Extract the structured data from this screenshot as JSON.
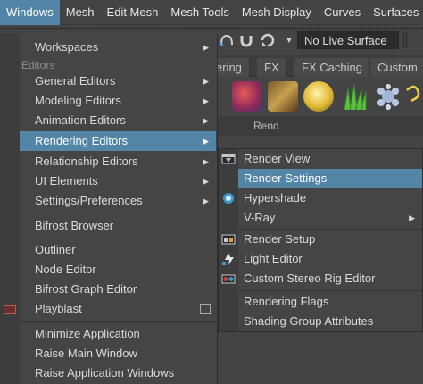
{
  "menubar": {
    "items": [
      "Windows",
      "Mesh",
      "Edit Mesh",
      "Mesh Tools",
      "Mesh Display",
      "Curves",
      "Surfaces"
    ],
    "active_index": 0
  },
  "statusline": {
    "live_surface": "No Live Surface"
  },
  "shelf": {
    "tabs": [
      "ering",
      "FX",
      "FX Caching",
      "Custom"
    ],
    "partial_label": "Rend"
  },
  "windows_menu": {
    "items": [
      {
        "label": "Workspaces",
        "submenu": true
      },
      {
        "caption": "Editors"
      },
      {
        "label": "General Editors",
        "submenu": true
      },
      {
        "label": "Modeling Editors",
        "submenu": true
      },
      {
        "label": "Animation Editors",
        "submenu": true
      },
      {
        "label": "Rendering Editors",
        "submenu": true,
        "active": true
      },
      {
        "label": "Relationship Editors",
        "submenu": true
      },
      {
        "label": "UI Elements",
        "submenu": true
      },
      {
        "label": "Settings/Preferences",
        "submenu": true
      },
      {
        "label": "Bifrost Browser"
      },
      {
        "label": "Outliner"
      },
      {
        "label": "Node Editor"
      },
      {
        "label": "Bifrost Graph Editor"
      },
      {
        "label": "Playblast",
        "option_box": true
      },
      {
        "label": "Minimize Application"
      },
      {
        "label": "Raise Main Window"
      },
      {
        "label": "Raise Application Windows"
      }
    ],
    "arrow_glyph": "▶"
  },
  "rendering_submenu": {
    "items": [
      {
        "label": "Render View",
        "icon": "render-view-icon"
      },
      {
        "label": "Render Settings",
        "icon": "",
        "active": true
      },
      {
        "label": "Hypershade",
        "icon": "hypershade-icon"
      },
      {
        "label": "V-Ray",
        "submenu": true
      },
      {
        "label": "Render Setup",
        "icon": "render-setup-icon"
      },
      {
        "label": "Light Editor",
        "icon": "light-editor-icon"
      },
      {
        "label": "Custom Stereo Rig Editor",
        "icon": "stereo-rig-icon"
      },
      {
        "label": "Rendering Flags"
      },
      {
        "label": "Shading Group Attributes"
      }
    ]
  },
  "colors": {
    "highlight": "#5285a6",
    "menu_bg": "#454545",
    "ui_bg": "#444444"
  }
}
